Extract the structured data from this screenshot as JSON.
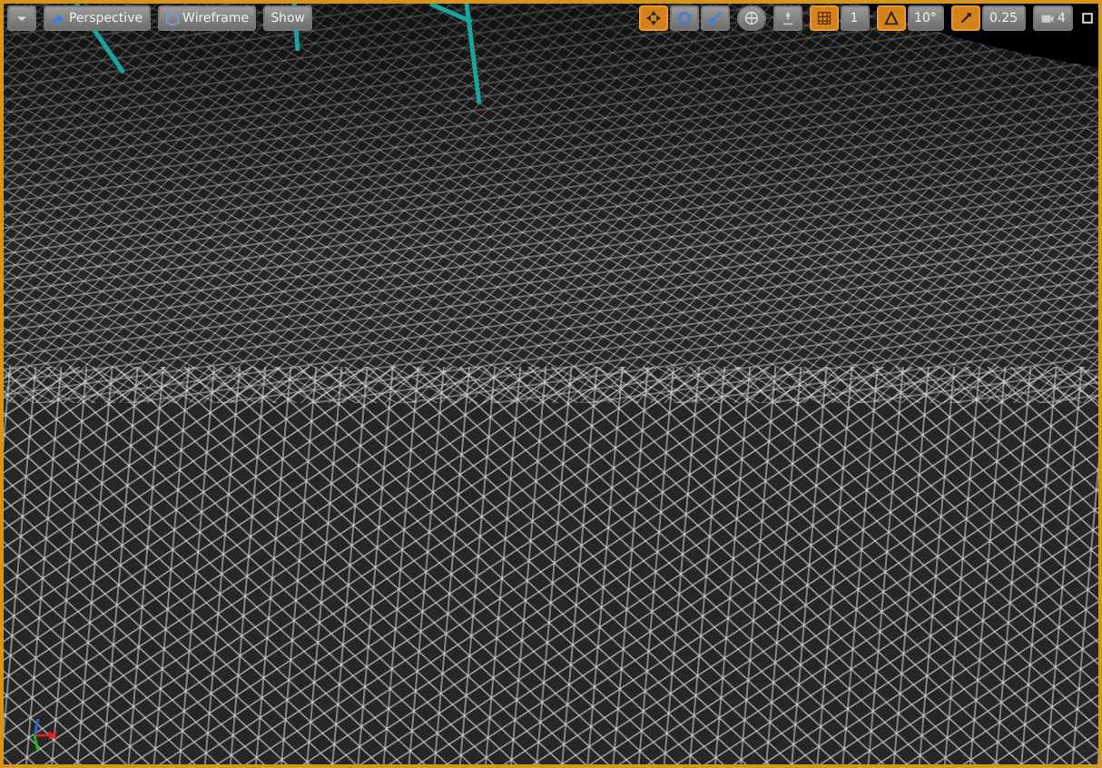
{
  "viewport": {
    "active": true
  },
  "left_toolbar": [
    {
      "kind": "menu"
    },
    {
      "kind": "view",
      "label": "Perspective"
    },
    {
      "kind": "mode",
      "label": "Wireframe"
    },
    {
      "kind": "plain",
      "label": "Show"
    }
  ],
  "transform_tools": [
    {
      "kind": "translate",
      "selected": true
    },
    {
      "kind": "rotate",
      "selected": false
    },
    {
      "kind": "scale",
      "selected": false
    }
  ],
  "snapping": [
    {
      "kind": "surface",
      "selected": false
    },
    {
      "kind": "grid",
      "selected": true,
      "value": "1"
    },
    {
      "kind": "rotate",
      "selected": true,
      "value": "10°"
    },
    {
      "kind": "scale",
      "selected": true,
      "value": "0.25"
    }
  ],
  "camera_speed": {
    "value": "4"
  }
}
